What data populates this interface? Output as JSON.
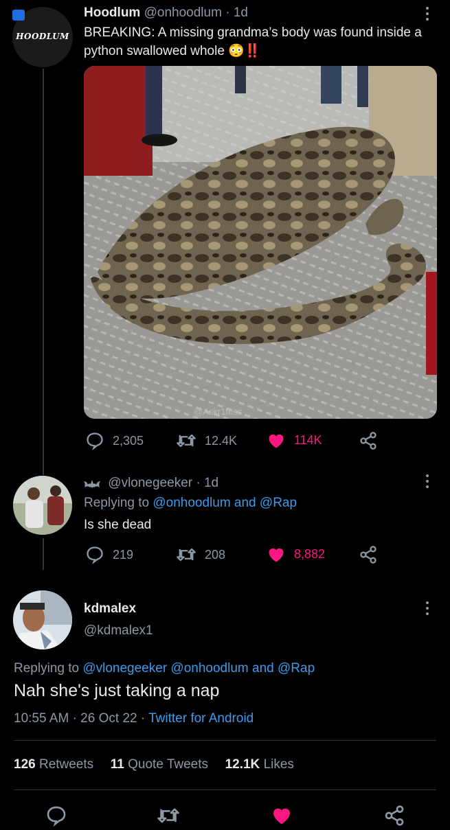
{
  "colors": {
    "background": "#000000",
    "text": "#e7e9ea",
    "muted": "#8b98a5",
    "link": "#3d9be9",
    "like": "#f91880"
  },
  "tweet1": {
    "avatar_text": "HOODLUM",
    "name": "Hoodlum",
    "handle": "@onhoodlum",
    "time": "1d",
    "text": "BREAKING: A missing grandma’s body was found inside a python swallowed whole",
    "emoji": "😳‼️",
    "image_watermark": "@Askr1fess",
    "replies": "2,305",
    "retweets": "12.4K",
    "likes": "114K"
  },
  "tweet2": {
    "handle": "@vlonegeeker",
    "time": "1d",
    "replying_prefix": "Replying to",
    "replying_to": "@onhoodlum and @Rap",
    "text": "Is she dead",
    "replies": "219",
    "retweets": "208",
    "likes": "8,882"
  },
  "main_tweet": {
    "name": "kdmalex",
    "handle": "@kdmalex1",
    "replying_prefix": "Replying to",
    "replying_to": "@vlonegeeker @onhoodlum and @Rap",
    "text": "Nah she's just taking a nap",
    "time": "10:55 AM",
    "date": "26 Oct 22",
    "source": "Twitter for Android",
    "retweets_count": "126",
    "retweets_label": "Retweets",
    "quotes_count": "11",
    "quotes_label": "Quote Tweets",
    "likes_count": "12.1K",
    "likes_label": "Likes"
  },
  "icons": [
    "reply-icon",
    "retweet-icon",
    "like-icon",
    "share-icon",
    "more-icon"
  ]
}
